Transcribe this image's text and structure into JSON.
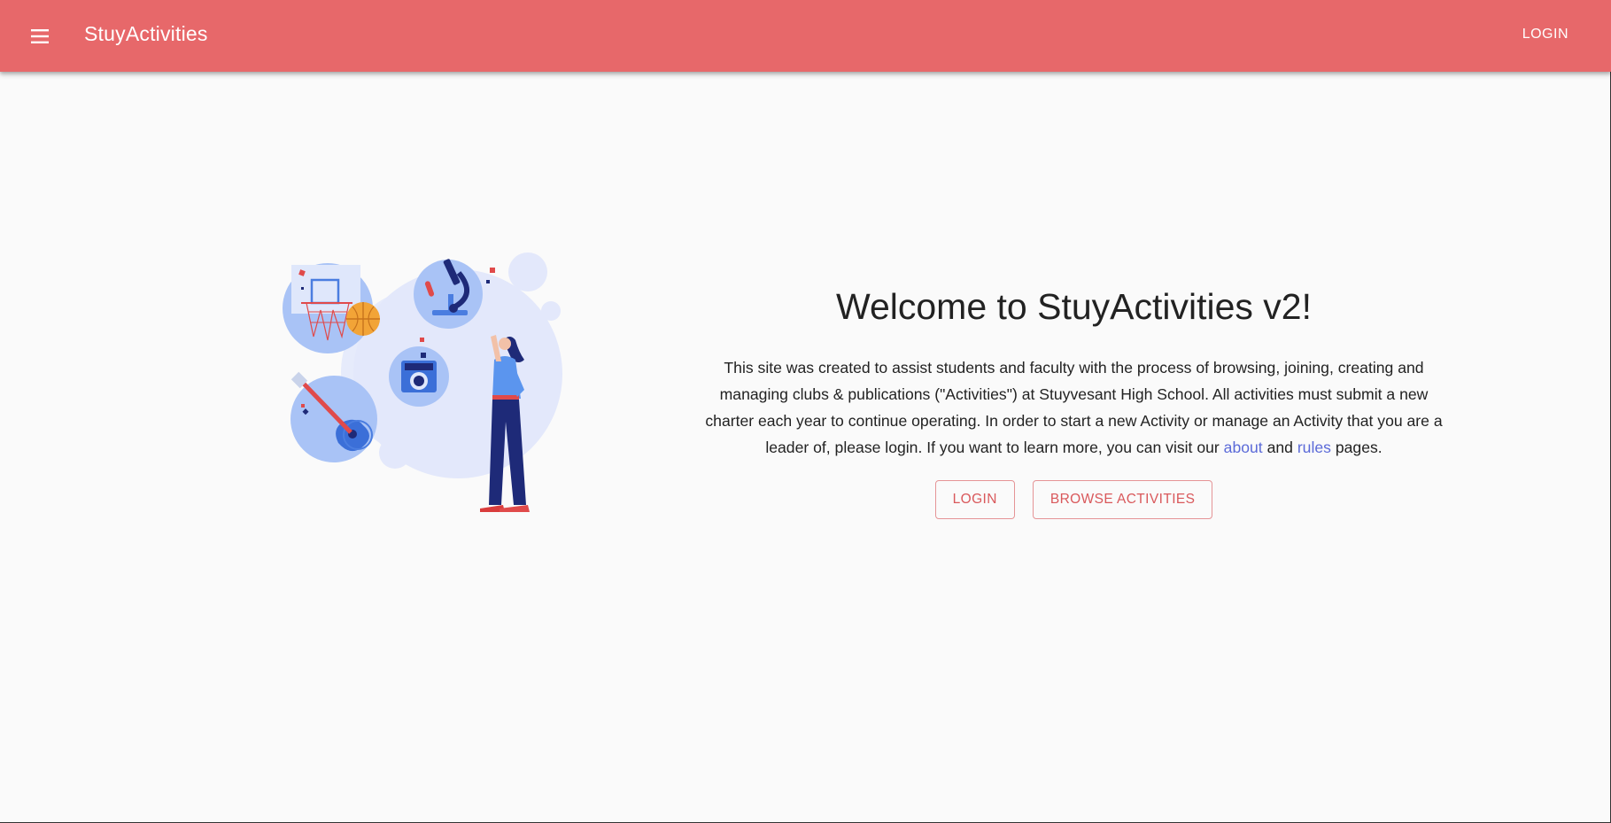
{
  "appbar": {
    "title": "StuyActivities",
    "login_label": "LOGIN",
    "menu_icon": "menu-icon",
    "background": "#e7686a"
  },
  "hero": {
    "heading": "Welcome to StuyActivities v2!",
    "body_part1": "This site was created to assist students and faculty with the process of browsing, joining, creating and managing clubs & publications (\"Activities\") at Stuyvesant High School. All activities must submit a new charter each year to continue operating. In order to start a new Activity or manage an Activity that you are a leader of, please login. If you want to learn more, you can visit our ",
    "about_link": "about",
    "between_links": " and ",
    "rules_link": "rules",
    "body_part2": " pages.",
    "login_button": "LOGIN",
    "browse_button": "BROWSE ACTIVITIES",
    "link_color": "#5b6ad8",
    "button_color": "#d9585b"
  },
  "illustration": {
    "icons": [
      "basketball-hoop-icon",
      "basketball-icon",
      "microscope-icon",
      "camera-icon",
      "guitar-icon",
      "woman-figure"
    ]
  }
}
